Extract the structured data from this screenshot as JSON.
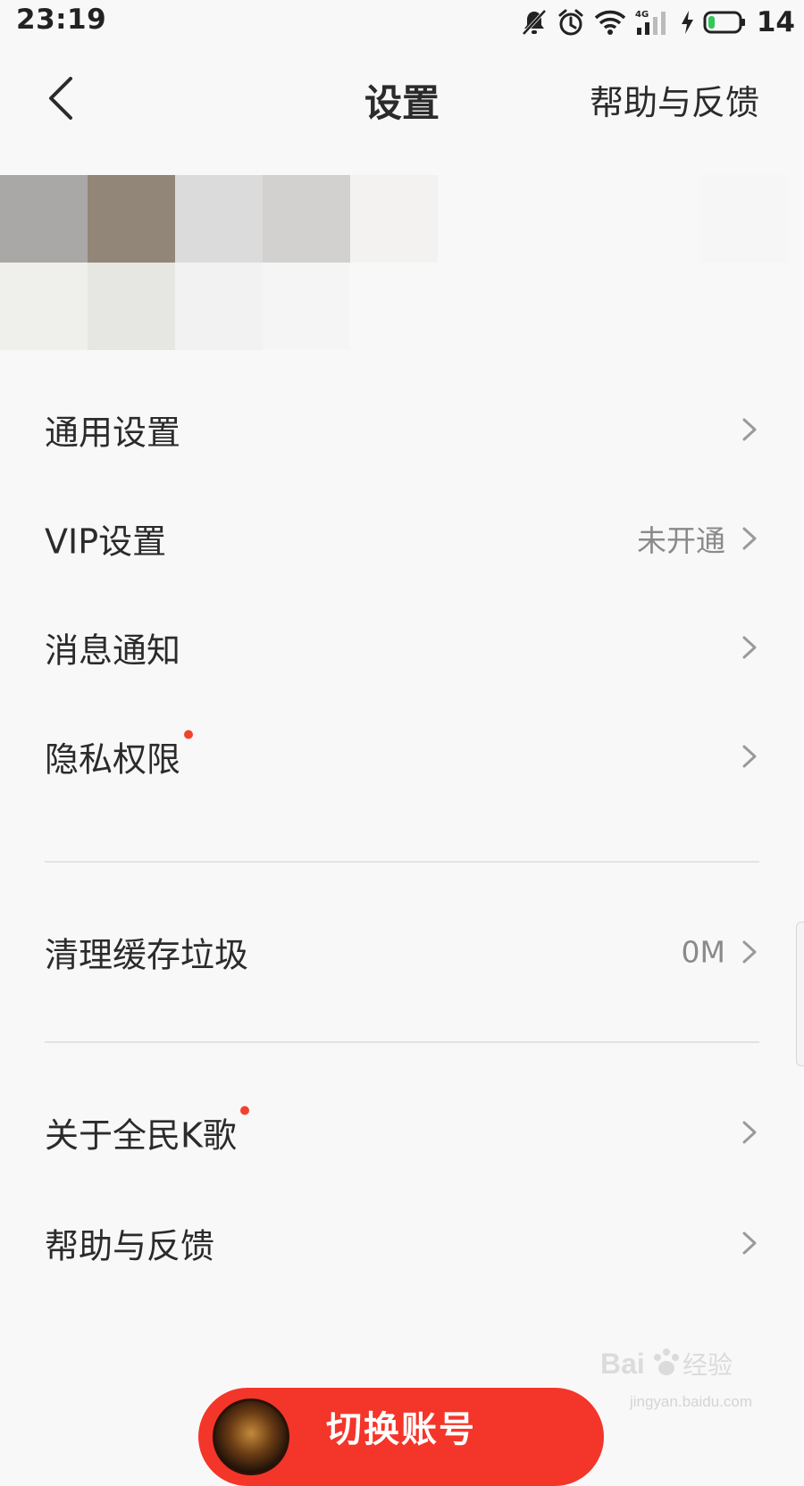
{
  "status_bar": {
    "time": "23:19",
    "network": "4G",
    "battery": "14",
    "icons": [
      "mute-icon",
      "alarm-icon",
      "wifi-icon",
      "signal-4g-icon",
      "charging-icon",
      "battery-icon"
    ]
  },
  "nav": {
    "back_icon": "chevron-left-icon",
    "title": "设置",
    "right_action": "帮助与反馈"
  },
  "banner": {
    "pixel_colors": [
      [
        "#a9a8a6",
        "#928678",
        "#dcdbdc",
        "#d2d1d0",
        "#f3f2f0",
        "#f8f8f8",
        "#f8f8f8",
        "#f8f8f8",
        "#f6f6f6"
      ],
      [
        "#efefec",
        "#e6e6e3",
        "#f2f2f2",
        "#f5f5f5",
        "#f8f8f8",
        "#f8f8f8",
        "#f8f8f8",
        "#f8f8f8",
        "#f8f8f8"
      ]
    ]
  },
  "settings": {
    "general": {
      "label": "通用设置"
    },
    "vip": {
      "label": "VIP设置",
      "value": "未开通"
    },
    "notifications": {
      "label": "消息通知"
    },
    "privacy": {
      "label": "隐私权限",
      "has_badge": true
    },
    "cache": {
      "label": "清理缓存垃圾",
      "value": "0M"
    },
    "about": {
      "label": "关于全民K歌",
      "has_badge": true
    },
    "help": {
      "label": "帮助与反馈"
    }
  },
  "footer": {
    "switch_account_label": "切换账号"
  },
  "watermark": {
    "url": "jingyan.baidu.com"
  },
  "colors": {
    "background": "#f8f8f8",
    "text": "#2b2b2b",
    "secondary_text": "#8a8a8a",
    "chevron": "#9a9a9a",
    "badge_dot": "#f2422b",
    "primary_button": "#f4352a"
  }
}
